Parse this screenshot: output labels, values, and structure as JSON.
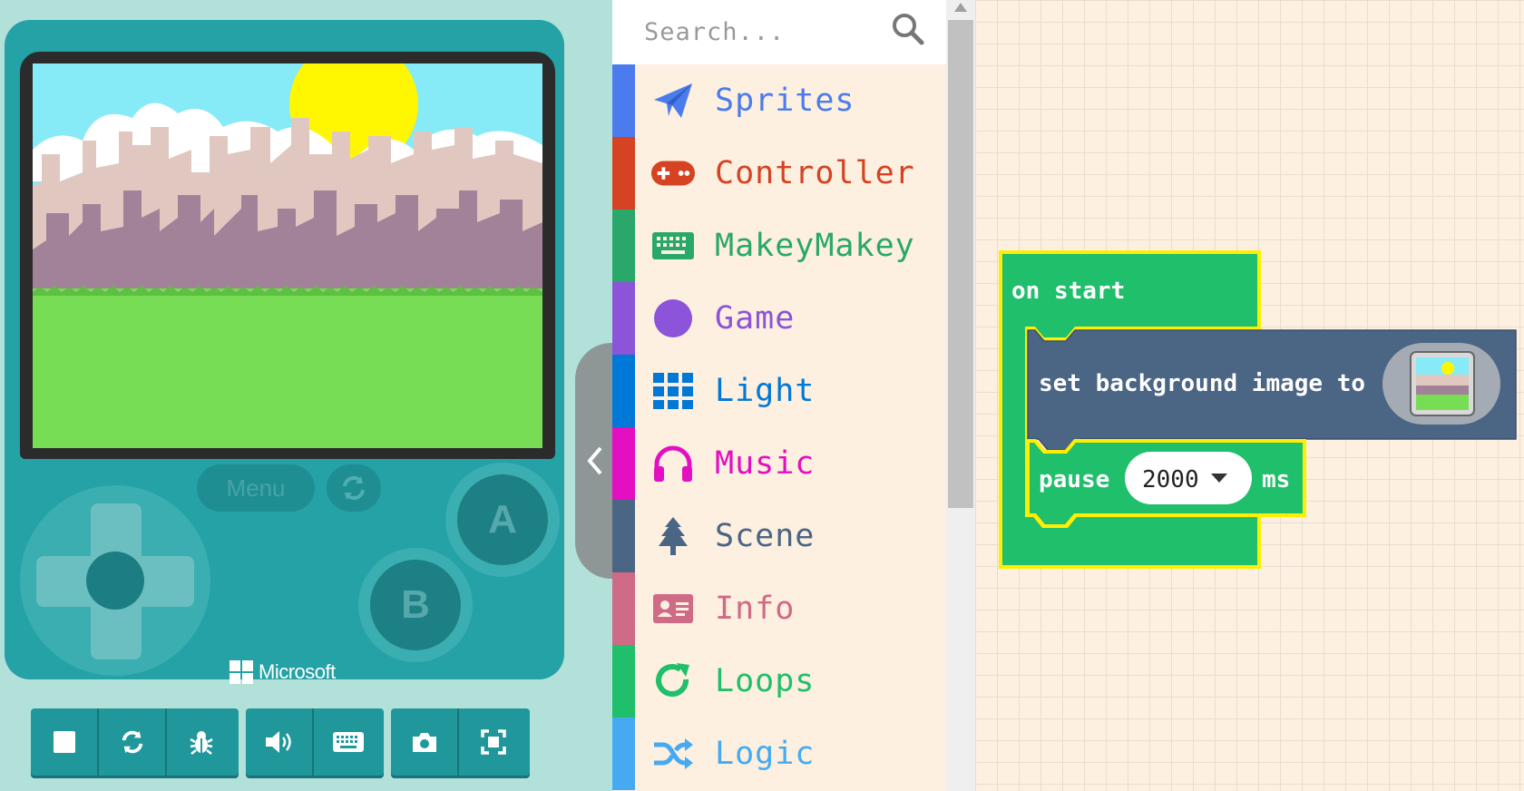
{
  "simulator": {
    "menu_label": "Menu",
    "button_a": "A",
    "button_b": "B",
    "brand": "Microsoft",
    "toolbar": [
      "stop",
      "restart",
      "debug",
      "mute",
      "keyboard",
      "screenshot",
      "fullscreen"
    ]
  },
  "toolbox": {
    "search_placeholder": "Search...",
    "categories": [
      {
        "label": "Sprites",
        "color": "#4b7bec",
        "icon": "paper-plane-icon"
      },
      {
        "label": "Controller",
        "color": "#d54322",
        "icon": "gamepad-icon"
      },
      {
        "label": "MakeyMakey",
        "color": "#2aa86b",
        "icon": "keyboard-icon"
      },
      {
        "label": "Game",
        "color": "#8b54d9",
        "icon": "circle-icon"
      },
      {
        "label": "Light",
        "color": "#0078d7",
        "icon": "grid-icon"
      },
      {
        "label": "Music",
        "color": "#e30fc0",
        "icon": "headphones-icon"
      },
      {
        "label": "Scene",
        "color": "#4b6584",
        "icon": "tree-icon"
      },
      {
        "label": "Info",
        "color": "#cf6a87",
        "icon": "id-card-icon"
      },
      {
        "label": "Loops",
        "color": "#20bf6b",
        "icon": "refresh-icon"
      },
      {
        "label": "Logic",
        "color": "#45aaf2",
        "icon": "shuffle-icon"
      }
    ]
  },
  "blocks": {
    "on_start": "on start",
    "set_background": "set background image to",
    "pause": "pause",
    "pause_value": "2000",
    "pause_unit": "ms"
  },
  "colors": {
    "loops_green": "#20bf6b",
    "scene_blue": "#4b6584",
    "highlight": "#ffee00"
  }
}
